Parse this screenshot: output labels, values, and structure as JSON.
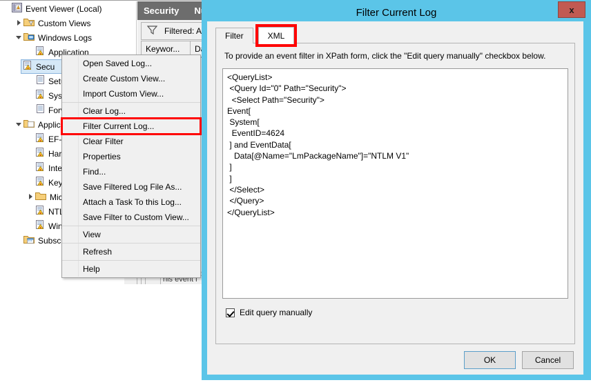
{
  "event_viewer": {
    "tree": [
      {
        "label": "Event Viewer (Local)",
        "icon": "event-viewer-icon",
        "indent": 0,
        "twisty": "none",
        "selected": false
      },
      {
        "label": "Custom Views",
        "icon": "custom-views-folder-icon",
        "indent": 1,
        "twisty": "collapsed",
        "selected": false
      },
      {
        "label": "Windows Logs",
        "icon": "windows-logs-folder-icon",
        "indent": 1,
        "twisty": "expanded",
        "selected": false
      },
      {
        "label": "Application",
        "icon": "log-icon",
        "indent": 2,
        "twisty": "none",
        "selected": false
      },
      {
        "label": "Secu",
        "icon": "log-icon",
        "indent": 2,
        "twisty": "none",
        "selected": true
      },
      {
        "label": "Setup",
        "icon": "log-plain-icon",
        "indent": 2,
        "twisty": "none",
        "selected": false
      },
      {
        "label": "Syste",
        "icon": "log-icon",
        "indent": 2,
        "twisty": "none",
        "selected": false
      },
      {
        "label": "Forw",
        "icon": "log-plain-icon",
        "indent": 2,
        "twisty": "none",
        "selected": false
      },
      {
        "label": "Applicat",
        "icon": "applications-folder-icon",
        "indent": 1,
        "twisty": "expanded",
        "selected": false
      },
      {
        "label": "EF-P",
        "icon": "log-icon",
        "indent": 2,
        "twisty": "none",
        "selected": false
      },
      {
        "label": "Hard",
        "icon": "log-icon",
        "indent": 2,
        "twisty": "none",
        "selected": false
      },
      {
        "label": "Inter",
        "icon": "log-icon",
        "indent": 2,
        "twisty": "none",
        "selected": false
      },
      {
        "label": "Key I",
        "icon": "log-icon",
        "indent": 2,
        "twisty": "none",
        "selected": false
      },
      {
        "label": "Micr",
        "icon": "folder-icon",
        "indent": 2,
        "twisty": "collapsed",
        "selected": false
      },
      {
        "label": "NTLI",
        "icon": "log-icon",
        "indent": 2,
        "twisty": "none",
        "selected": false
      },
      {
        "label": "Winc",
        "icon": "log-icon",
        "indent": 2,
        "twisty": "none",
        "selected": false
      },
      {
        "label": "Subscrip",
        "icon": "subscriptions-icon",
        "indent": 1,
        "twisty": "none",
        "selected": false
      }
    ],
    "pane_header": {
      "title": "Security",
      "secondary": "Num"
    },
    "filter_bar": {
      "icon": "funnel-icon",
      "text": "Filtered: A"
    },
    "columns": [
      {
        "label": "Keywor...",
        "width": 72
      },
      {
        "label": "Date",
        "width": 60
      }
    ],
    "status_text": "his event i"
  },
  "context_menu": {
    "items": [
      {
        "label": "Open Saved Log...",
        "highlighted": false,
        "separator_after": false
      },
      {
        "label": "Create Custom View...",
        "highlighted": false,
        "separator_after": false
      },
      {
        "label": "Import Custom View...",
        "highlighted": false,
        "separator_after": true
      },
      {
        "label": "Clear Log...",
        "highlighted": false,
        "separator_after": false
      },
      {
        "label": "Filter Current Log...",
        "highlighted": true,
        "separator_after": false
      },
      {
        "label": "Clear Filter",
        "highlighted": false,
        "separator_after": false
      },
      {
        "label": "Properties",
        "highlighted": false,
        "separator_after": false
      },
      {
        "label": "Find...",
        "highlighted": false,
        "separator_after": false
      },
      {
        "label": "Save Filtered Log File As...",
        "highlighted": false,
        "separator_after": false
      },
      {
        "label": "Attach a Task To this Log...",
        "highlighted": false,
        "separator_after": false
      },
      {
        "label": "Save Filter to Custom View...",
        "highlighted": false,
        "separator_after": true
      },
      {
        "label": "View",
        "highlighted": false,
        "separator_after": true
      },
      {
        "label": "Refresh",
        "highlighted": false,
        "separator_after": true
      },
      {
        "label": "Help",
        "highlighted": false,
        "separator_after": false
      }
    ]
  },
  "dialog": {
    "title": "Filter Current Log",
    "close_label": "x",
    "tabs": [
      {
        "label": "Filter",
        "active": false,
        "marked": false
      },
      {
        "label": "XML",
        "active": true,
        "marked": true
      }
    ],
    "instruction": "To provide an event filter in XPath form, click the \"Edit query manually\" checkbox below.",
    "xml_query": "<QueryList>\n <Query Id=\"0\" Path=\"Security\">\n  <Select Path=\"Security\">\nEvent[\n System[\n  EventID=4624\n ] and EventData[\n   Data[@Name=\"LmPackageName\"]=\"NTLM V1\"\n ]\n ]\n </Select>\n </Query>\n</QueryList>",
    "checkbox": {
      "label": "Edit query manually",
      "checked": true
    },
    "buttons": [
      {
        "label": "OK",
        "default": true
      },
      {
        "label": "Cancel",
        "default": false
      }
    ]
  },
  "colors": {
    "dialog_frame": "#5bc5e8",
    "close_button": "#c15a52",
    "highlight_red": "#ff0000",
    "pane_header": "#6d6d6d",
    "selection": "#d5e8f7"
  }
}
